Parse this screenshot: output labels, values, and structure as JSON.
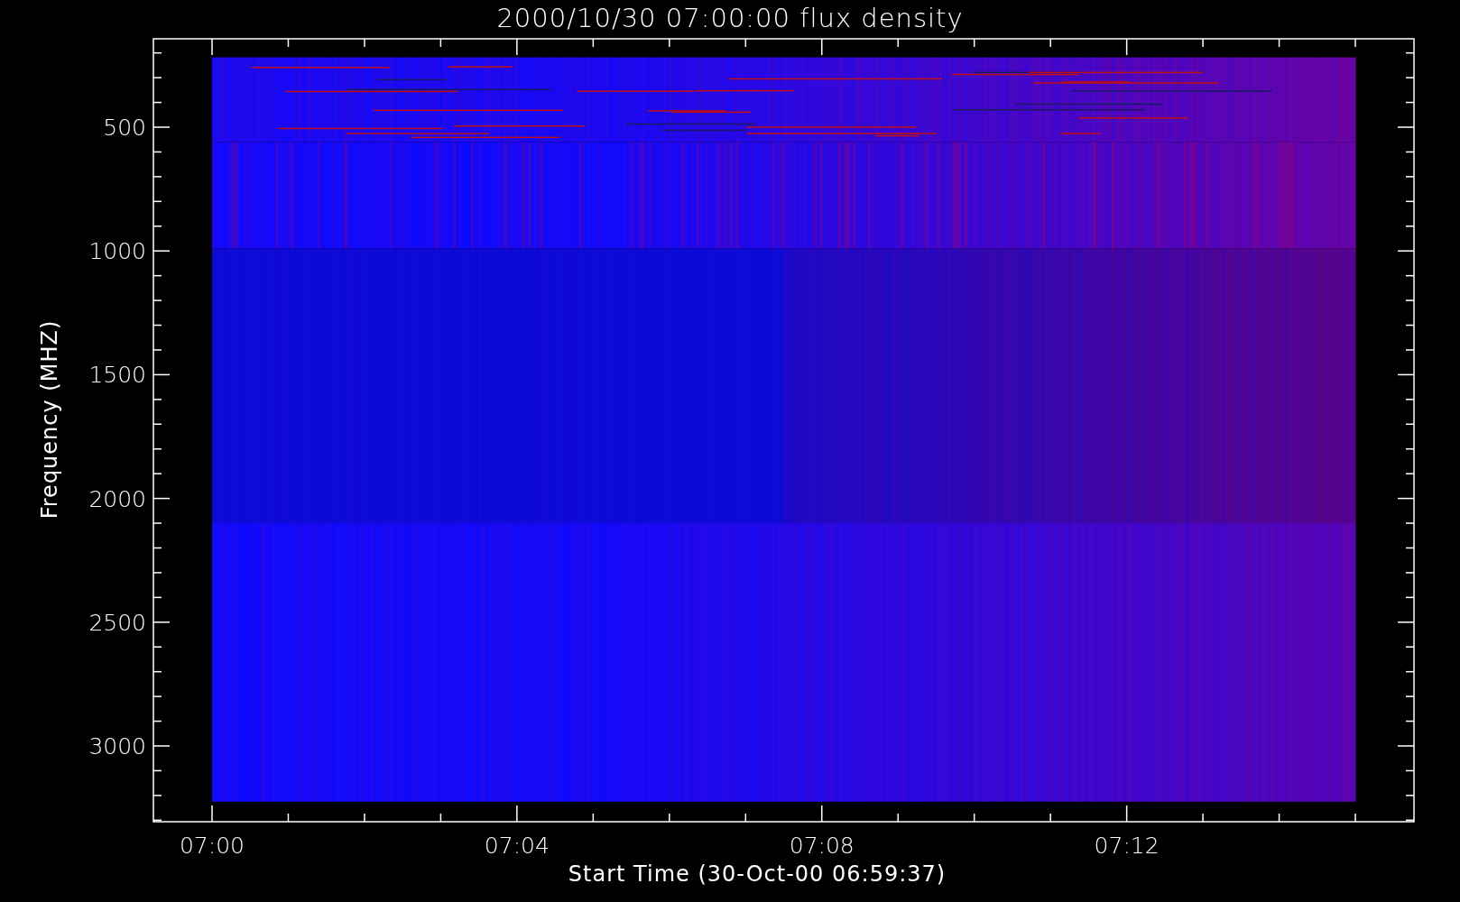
{
  "title": "2000/10/30 07:00:00 flux density",
  "y_axis": {
    "label": "Frequency (MHZ)",
    "ticks": [
      "500",
      "1000",
      "1500",
      "2000",
      "2500",
      "3000"
    ]
  },
  "x_axis": {
    "label": "Start Time (30-Oct-00 06:59:37)",
    "ticks": [
      "07:00",
      "07:04",
      "07:08",
      "07:12"
    ]
  }
}
